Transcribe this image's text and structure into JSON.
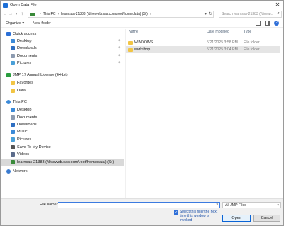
{
  "window": {
    "title": "Open Data File"
  },
  "address": {
    "crumbs": [
      "This PC",
      "learnsas-21383 (\\\\liveweb.sas.com\\root\\homedata) (S:)"
    ],
    "search_placeholder": "Search learnsas-21383 (\\\\livew..."
  },
  "toolbar": {
    "organize": "Organize ▾",
    "new_folder": "New folder"
  },
  "nav": {
    "items": [
      {
        "label": "Quick access",
        "icon": "star-icon",
        "color": "#2b6fd6",
        "indent": 0,
        "pinned": false
      },
      {
        "label": "Desktop",
        "icon": "desktop-icon",
        "color": "#3b8ad8",
        "indent": 1,
        "pinned": true
      },
      {
        "label": "Downloads",
        "icon": "download-icon",
        "color": "#2f6fc2",
        "indent": 1,
        "pinned": true
      },
      {
        "label": "Documents",
        "icon": "documents-icon",
        "color": "#8c9bb0",
        "indent": 1,
        "pinned": true
      },
      {
        "label": "Pictures",
        "icon": "pictures-icon",
        "color": "#4aa0d8",
        "indent": 1,
        "pinned": true
      },
      {
        "label": "JMP 17 Annual License (64-bit)",
        "icon": "jmp-icon",
        "color": "#2a9d3f",
        "indent": 0,
        "pinned": false
      },
      {
        "label": "Favorites",
        "icon": "favorites-folder-icon",
        "color": "#f2c544",
        "indent": 1,
        "pinned": false
      },
      {
        "label": "Data",
        "icon": "data-folder-icon",
        "color": "#f2c544",
        "indent": 1,
        "pinned": false
      },
      {
        "label": "This PC",
        "icon": "pc-icon",
        "color": "#3b8ad8",
        "indent": 0,
        "pinned": false
      },
      {
        "label": "Desktop",
        "icon": "desktop-icon",
        "color": "#3b8ad8",
        "indent": 1,
        "pinned": false
      },
      {
        "label": "Documents",
        "icon": "documents-icon",
        "color": "#8c9bb0",
        "indent": 1,
        "pinned": false
      },
      {
        "label": "Downloads",
        "icon": "download-icon",
        "color": "#2f6fc2",
        "indent": 1,
        "pinned": false
      },
      {
        "label": "Music",
        "icon": "music-icon",
        "color": "#3b8ad8",
        "indent": 1,
        "pinned": false
      },
      {
        "label": "Pictures",
        "icon": "pictures-icon",
        "color": "#4aa0d8",
        "indent": 1,
        "pinned": false
      },
      {
        "label": "Save To My Device",
        "icon": "device-icon",
        "color": "#555555",
        "indent": 1,
        "pinned": false
      },
      {
        "label": "Videos",
        "icon": "videos-icon",
        "color": "#5b6b8a",
        "indent": 1,
        "pinned": false
      },
      {
        "label": "learnsas-21383 (\\\\liveweb.sas.com\\root\\homedata) (S:)",
        "icon": "network-drive-icon",
        "color": "#3a8a3a",
        "indent": 1,
        "pinned": false,
        "selected": true
      },
      {
        "label": "Network",
        "icon": "network-icon",
        "color": "#3a7bd0",
        "indent": 0,
        "pinned": false
      }
    ]
  },
  "columns": {
    "name": "Name",
    "date": "Date modified",
    "type": "Type"
  },
  "files": [
    {
      "name": "WINDOWS",
      "date": "5/21/2025 3:58 PM",
      "type": "File folder",
      "selected": false
    },
    {
      "name": "workshop",
      "date": "5/21/2025 3:04 PM",
      "type": "File folder",
      "selected": true
    }
  ],
  "bottom": {
    "file_name_label": "File name:",
    "file_name_value": "",
    "filter_value": "All JMP Files",
    "checkbox_label": "Select this filter the next time this window is invoked",
    "checkbox_checked": true,
    "open_label": "Open",
    "cancel_label": "Cancel"
  }
}
